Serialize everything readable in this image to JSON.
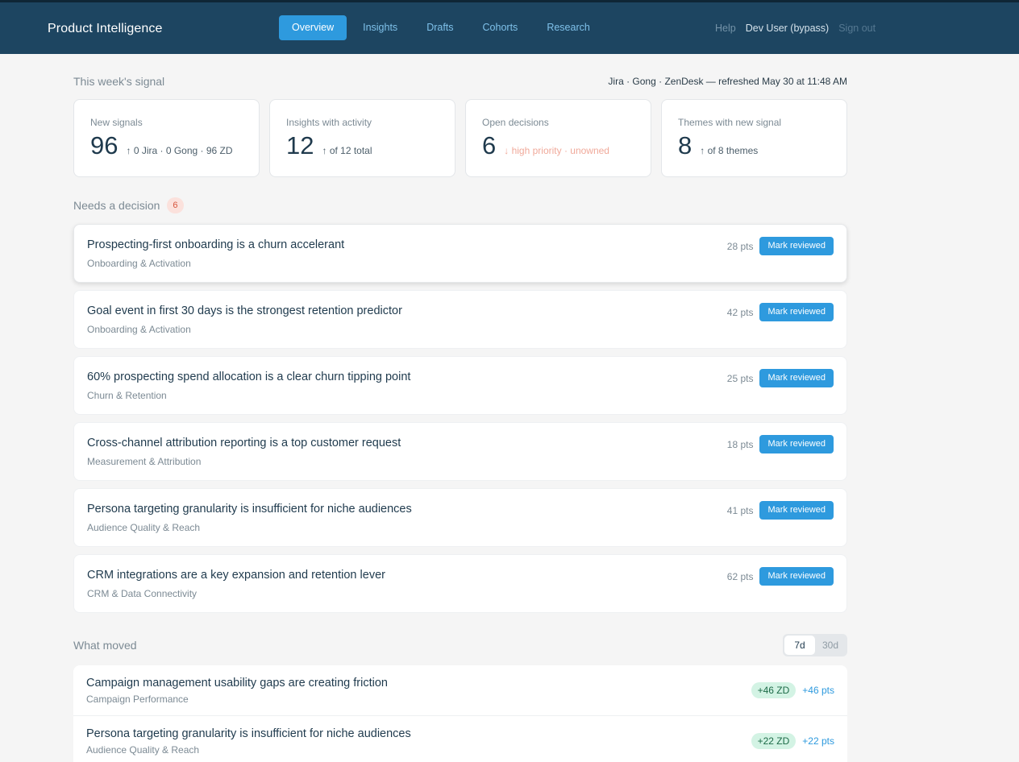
{
  "header": {
    "brand": "Product Intelligence",
    "nav": [
      {
        "label": "Overview",
        "active": true
      },
      {
        "label": "Insights",
        "active": false
      },
      {
        "label": "Drafts",
        "active": false
      },
      {
        "label": "Cohorts",
        "active": false
      },
      {
        "label": "Research",
        "active": false
      }
    ],
    "help": "Help",
    "user": "Dev User (bypass)",
    "signout": "Sign out"
  },
  "signal": {
    "title": "This week's signal",
    "sources": "Jira · Gong · ZenDesk — refreshed May 30 at 11:48 AM",
    "stats": [
      {
        "label": "New signals",
        "value": "96",
        "sub": "↑ 0 Jira · 0 Gong · 96 ZD"
      },
      {
        "label": "Insights with activity",
        "value": "12",
        "sub": "↑ of 12 total"
      },
      {
        "label": "Open decisions",
        "value": "6",
        "sub": "↓ high priority · unowned"
      },
      {
        "label": "Themes with new signal",
        "value": "8",
        "sub": "↑ of 8 themes"
      }
    ]
  },
  "needs": {
    "title": "Needs a decision",
    "count": "6",
    "button_label": "Mark reviewed",
    "items": [
      {
        "title": "Prospecting-first onboarding is a churn accelerant",
        "theme": "Onboarding & Activation",
        "pts": "28 pts"
      },
      {
        "title": "Goal event in first 30 days is the strongest retention predictor",
        "theme": "Onboarding & Activation",
        "pts": "42 pts"
      },
      {
        "title": "60% prospecting spend allocation is a clear churn tipping point",
        "theme": "Churn & Retention",
        "pts": "25 pts"
      },
      {
        "title": "Cross-channel attribution reporting is a top customer request",
        "theme": "Measurement & Attribution",
        "pts": "18 pts"
      },
      {
        "title": "Persona targeting granularity is insufficient for niche audiences",
        "theme": "Audience Quality & Reach",
        "pts": "41 pts"
      },
      {
        "title": "CRM integrations are a key expansion and retention lever",
        "theme": "CRM & Data Connectivity",
        "pts": "62 pts"
      }
    ]
  },
  "moved": {
    "title": "What moved",
    "toggle": [
      "7d",
      "30d"
    ],
    "items": [
      {
        "title": "Campaign management usability gaps are creating friction",
        "theme": "Campaign Performance",
        "badge": "+46 ZD",
        "delta": "+46 pts"
      },
      {
        "title": "Persona targeting granularity is insufficient for niche audiences",
        "theme": "Audience Quality & Reach",
        "badge": "+22 ZD",
        "delta": "+22 pts"
      }
    ]
  }
}
